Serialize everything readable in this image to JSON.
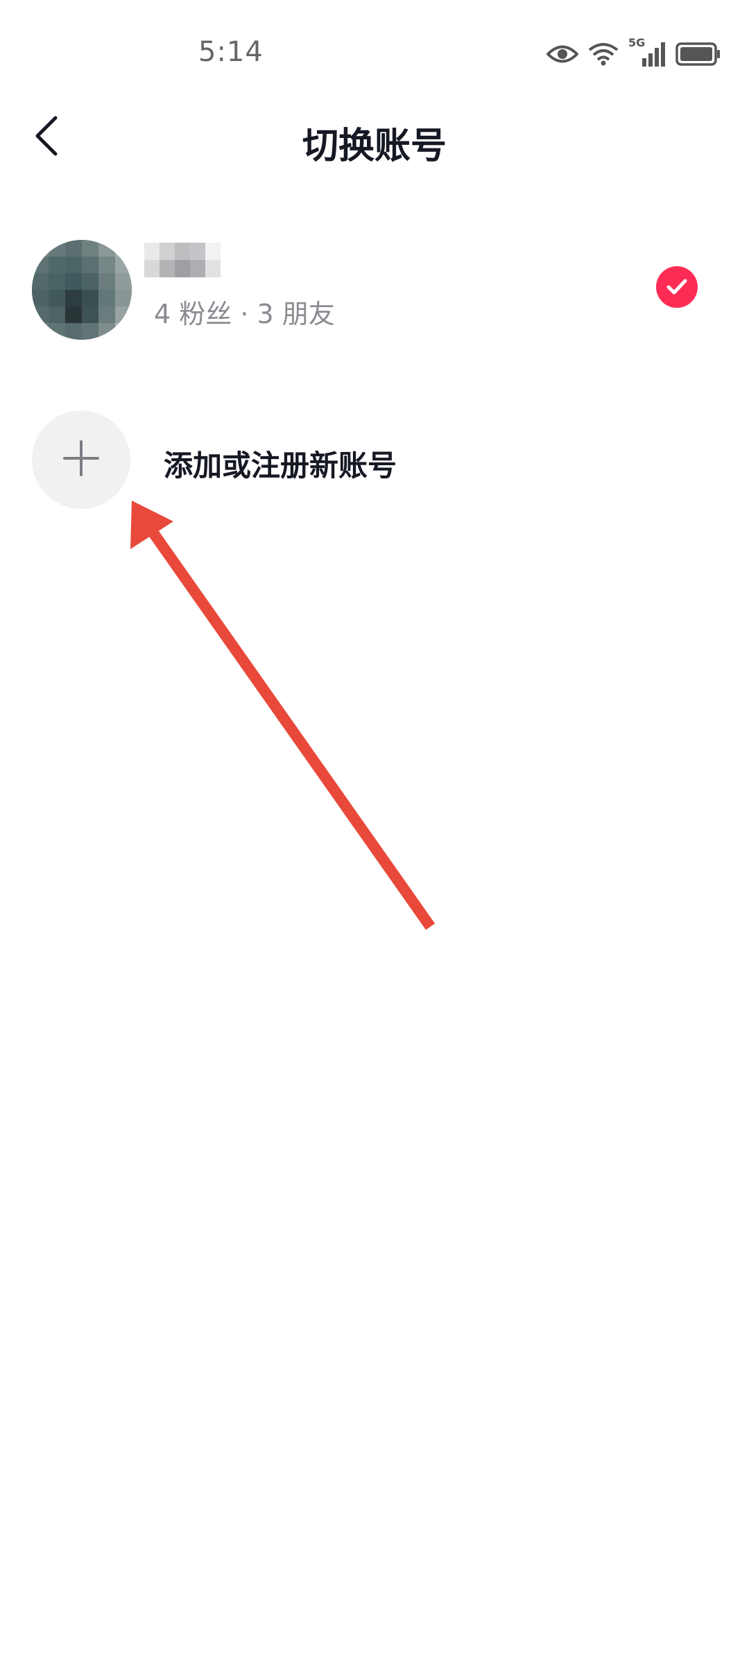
{
  "status_bar": {
    "time": "5:14",
    "network": "5G",
    "icons": [
      "eye-icon",
      "wifi-icon",
      "signal-icon",
      "battery-icon"
    ]
  },
  "header": {
    "title": "切换账号",
    "back_icon": "chevron-left-icon"
  },
  "accounts": [
    {
      "stats": "4 粉丝 · 3 朋友",
      "selected": true
    }
  ],
  "add_account": {
    "label": "添加或注册新账号",
    "icon": "plus-icon"
  },
  "colors": {
    "accent": "#fe2c55",
    "title_text": "#161823",
    "secondary_text": "#8a8b91",
    "add_circle_bg": "#f1f1f2",
    "annotation_arrow": "#e8493a"
  }
}
